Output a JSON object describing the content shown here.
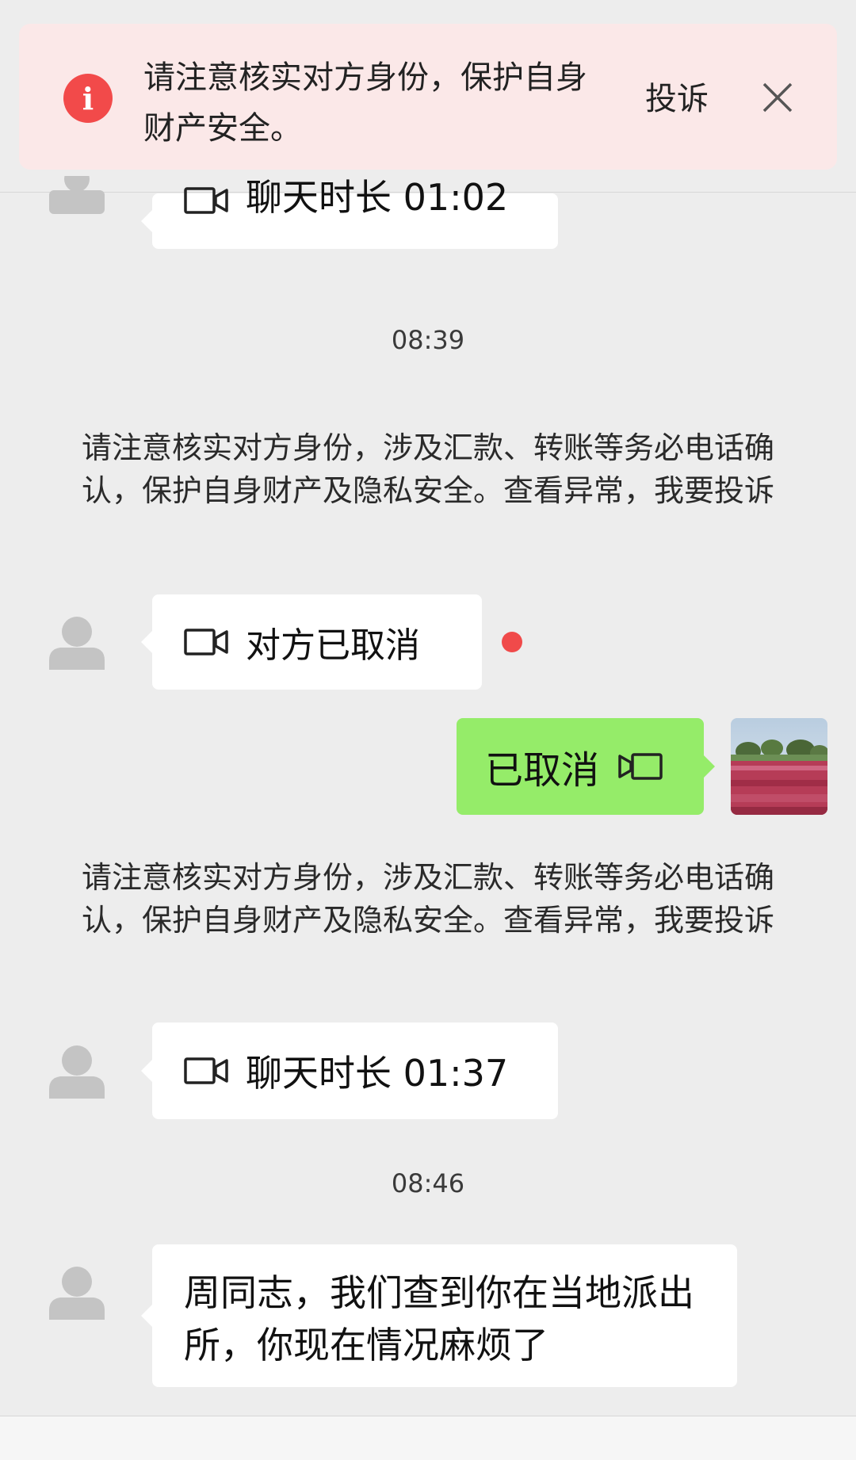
{
  "banner": {
    "text": "请注意核实对方身份，保护自身财产安全。",
    "icon": "info-icon",
    "complain_label": "投诉",
    "close_icon": "close-icon",
    "bg_color": "#fbe8e8",
    "icon_color": "#f24a4a"
  },
  "messages": {
    "call1": {
      "label": "聊天时长 01:02",
      "icon": "video-camera-icon"
    },
    "time1": "08:39",
    "notice1": {
      "text": "请注意核实对方身份，涉及汇款、转账等务必电话确认，保护自身财产及隐私安全。",
      "link1": "查看异常",
      "sep": "，",
      "link2": "我要投诉"
    },
    "call2": {
      "label": "对方已取消",
      "icon": "video-camera-icon",
      "unread_dot_color": "#f04a4a"
    },
    "call3": {
      "label": "已取消",
      "icon": "video-camera-icon",
      "bubble_color": "#95ec69"
    },
    "notice2": {
      "text": "请注意核实对方身份，涉及汇款、转账等务必电话确认，保护自身财产及隐私安全。",
      "link1": "查看异常",
      "sep": "，",
      "link2": "我要投诉"
    },
    "call4": {
      "label": "聊天时长 01:37",
      "icon": "video-camera-icon"
    },
    "time2": "08:46",
    "text1": "周同志，我们查到你在当地派出所，你现在情况麻烦了"
  }
}
